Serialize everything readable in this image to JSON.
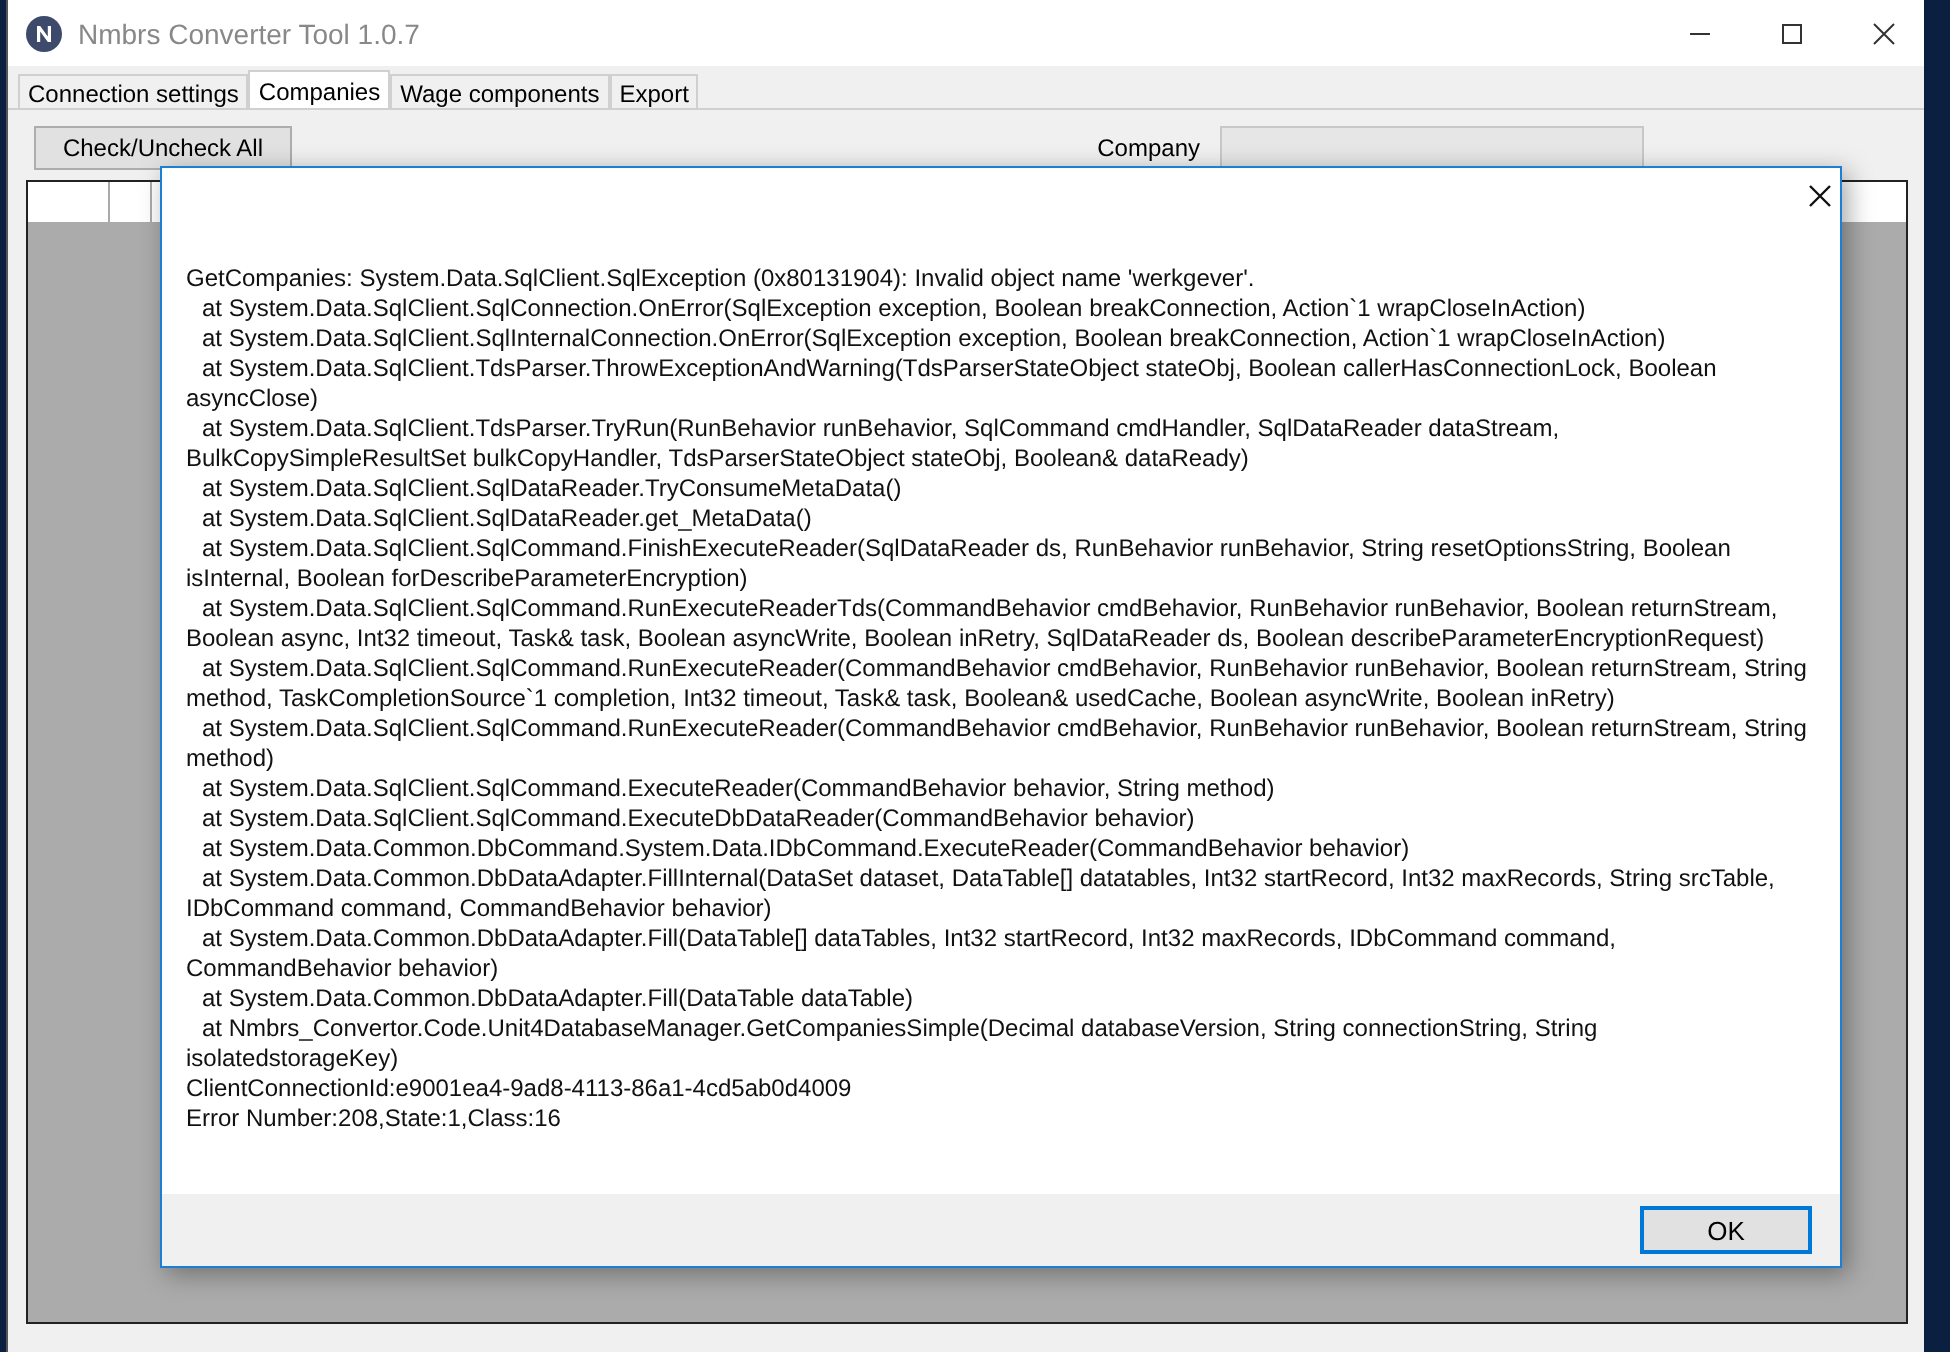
{
  "window": {
    "title": "Nmbrs Converter Tool 1.0.7"
  },
  "tabs": [
    {
      "label": "Connection  settings",
      "selected": false
    },
    {
      "label": "Companies",
      "selected": true
    },
    {
      "label": "Wage components",
      "selected": false
    },
    {
      "label": "Export",
      "selected": false
    }
  ],
  "toolbar": {
    "check_button": "Check/Uncheck All",
    "company_label": "Company"
  },
  "dialog": {
    "lines": [
      {
        "kind": "text",
        "text": "GetCompanies: System.Data.SqlClient.SqlException (0x80131904): Invalid object name 'werkgever'."
      },
      {
        "kind": "frame",
        "text": "at System.Data.SqlClient.SqlConnection.OnError(SqlException exception, Boolean breakConnection, Action`1 wrapCloseInAction)"
      },
      {
        "kind": "frame",
        "text": "at System.Data.SqlClient.SqlInternalConnection.OnError(SqlException exception, Boolean breakConnection, Action`1 wrapCloseInAction)"
      },
      {
        "kind": "frame",
        "text": "at System.Data.SqlClient.TdsParser.ThrowExceptionAndWarning(TdsParserStateObject stateObj, Boolean callerHasConnectionLock, Boolean"
      },
      {
        "kind": "text",
        "text": "asyncClose)"
      },
      {
        "kind": "frame",
        "text": "at System.Data.SqlClient.TdsParser.TryRun(RunBehavior runBehavior, SqlCommand cmdHandler, SqlDataReader dataStream,"
      },
      {
        "kind": "text",
        "text": "BulkCopySimpleResultSet bulkCopyHandler, TdsParserStateObject stateObj, Boolean& dataReady)"
      },
      {
        "kind": "frame",
        "text": "at System.Data.SqlClient.SqlDataReader.TryConsumeMetaData()"
      },
      {
        "kind": "frame",
        "text": "at System.Data.SqlClient.SqlDataReader.get_MetaData()"
      },
      {
        "kind": "frame",
        "text": "at System.Data.SqlClient.SqlCommand.FinishExecuteReader(SqlDataReader ds, RunBehavior runBehavior, String resetOptionsString, Boolean"
      },
      {
        "kind": "text",
        "text": "isInternal, Boolean forDescribeParameterEncryption)"
      },
      {
        "kind": "frame",
        "text": "at System.Data.SqlClient.SqlCommand.RunExecuteReaderTds(CommandBehavior cmdBehavior, RunBehavior runBehavior, Boolean returnStream,"
      },
      {
        "kind": "text",
        "text": "Boolean async, Int32 timeout, Task& task, Boolean asyncWrite, Boolean inRetry, SqlDataReader ds, Boolean describeParameterEncryptionRequest)"
      },
      {
        "kind": "frame",
        "text": "at System.Data.SqlClient.SqlCommand.RunExecuteReader(CommandBehavior cmdBehavior, RunBehavior runBehavior, Boolean returnStream, String"
      },
      {
        "kind": "text",
        "text": "method, TaskCompletionSource`1 completion, Int32 timeout, Task& task, Boolean& usedCache, Boolean asyncWrite, Boolean inRetry)"
      },
      {
        "kind": "frame",
        "text": "at System.Data.SqlClient.SqlCommand.RunExecuteReader(CommandBehavior cmdBehavior, RunBehavior runBehavior, Boolean returnStream, String"
      },
      {
        "kind": "text",
        "text": "method)"
      },
      {
        "kind": "frame",
        "text": "at System.Data.SqlClient.SqlCommand.ExecuteReader(CommandBehavior behavior, String method)"
      },
      {
        "kind": "frame",
        "text": "at System.Data.SqlClient.SqlCommand.ExecuteDbDataReader(CommandBehavior behavior)"
      },
      {
        "kind": "frame",
        "text": "at System.Data.Common.DbCommand.System.Data.IDbCommand.ExecuteReader(CommandBehavior behavior)"
      },
      {
        "kind": "frame",
        "text": "at System.Data.Common.DbDataAdapter.FillInternal(DataSet dataset, DataTable[] datatables, Int32 startRecord, Int32 maxRecords, String srcTable,"
      },
      {
        "kind": "text",
        "text": "IDbCommand command, CommandBehavior behavior)"
      },
      {
        "kind": "frame",
        "text": "at System.Data.Common.DbDataAdapter.Fill(DataTable[] dataTables, Int32 startRecord, Int32 maxRecords, IDbCommand command,"
      },
      {
        "kind": "text",
        "text": "CommandBehavior behavior)"
      },
      {
        "kind": "frame",
        "text": "at System.Data.Common.DbDataAdapter.Fill(DataTable dataTable)"
      },
      {
        "kind": "frame",
        "text": "at Nmbrs_Convertor.Code.Unit4DatabaseManager.GetCompaniesSimple(Decimal databaseVersion, String connectionString, String"
      },
      {
        "kind": "text",
        "text": "isolatedstorageKey)"
      },
      {
        "kind": "text",
        "text": "ClientConnectionId:e9001ea4-9ad8-4113-86a1-4cd5ab0d4009"
      },
      {
        "kind": "text",
        "text": "Error Number:208,State:1,Class:16"
      }
    ],
    "ok_button": "OK"
  }
}
